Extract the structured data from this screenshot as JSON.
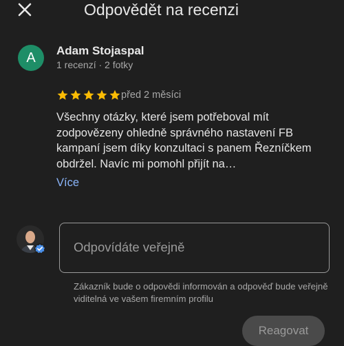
{
  "header": {
    "title": "Odpovědět na recenzi",
    "close_icon": "close-icon"
  },
  "review": {
    "avatar_letter": "A",
    "avatar_color": "#1e8e67",
    "author": "Adam Stojaspal",
    "author_meta": "1 recenzí · 2 fotky",
    "rating": 5,
    "rating_max": 5,
    "star_color": "#fbbc04",
    "date": "před 2 měsíci",
    "text": "Všechny otázky, které jsem potřeboval mít zodpovězeny ohledně správného nastavení FB kampaní jsem díky konzultaci s panem Řezníčkem obdržel. Navíc mi pomohl přijít na…",
    "more_label": "Více"
  },
  "reply": {
    "placeholder": "Odpovídáte veřejně",
    "value": "",
    "owner_avatar_icon": "owner-photo-verified-icon",
    "notice": "Zákazník bude o odpovědi informován a odpověď bude veřejně viditelná ve vašem firemním profilu",
    "submit_label": "Reagovat"
  }
}
